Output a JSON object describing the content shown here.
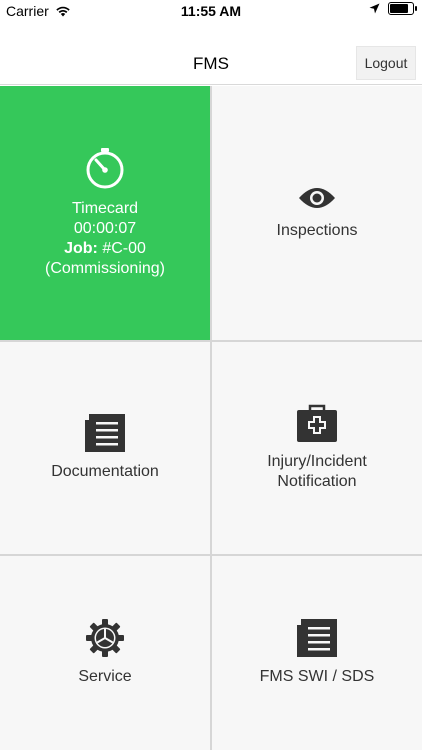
{
  "status": {
    "carrier": "Carrier",
    "time": "11:55 AM",
    "battery_level": 0.9
  },
  "nav": {
    "title": "FMS",
    "logout_label": "Logout"
  },
  "tiles": {
    "timecard": {
      "title": "Timecard",
      "elapsed": "00:00:07",
      "job_label": "Job:",
      "job_value": "#C-00",
      "job_type": "(Commissioning)",
      "icon": "stopwatch-icon",
      "color": "#35c85a"
    },
    "inspections": {
      "label": "Inspections",
      "icon": "eye-icon"
    },
    "documentation": {
      "label": "Documentation",
      "icon": "document-icon"
    },
    "injury": {
      "line1": "Injury/Incident",
      "line2": "Notification",
      "icon": "first-aid-kit-icon"
    },
    "service": {
      "label": "Service",
      "icon": "gear-icon"
    },
    "swi": {
      "label": "FMS SWI / SDS",
      "icon": "document-icon"
    }
  }
}
